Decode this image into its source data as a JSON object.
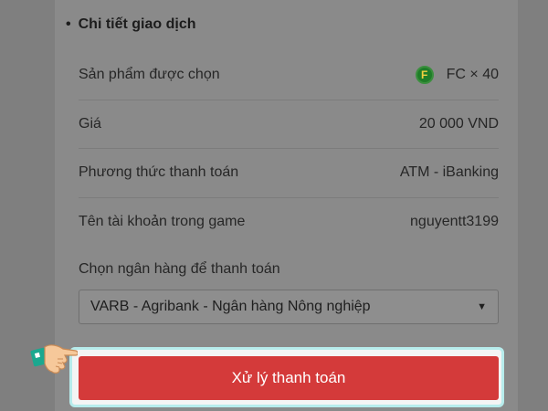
{
  "section": {
    "bullet": "•",
    "title": "Chi tiết giao dịch"
  },
  "rows": [
    {
      "label": "Sản phẩm được chọn",
      "value": "FC × 40",
      "icon": "fc-coin-icon",
      "icon_text": "F"
    },
    {
      "label": "Giá",
      "value": "20 000 VND"
    },
    {
      "label": "Phương thức thanh toán",
      "value": "ATM - iBanking"
    },
    {
      "label": "Tên tài khoản trong game",
      "value": "nguyentt3199"
    }
  ],
  "bank": {
    "label": "Chọn ngân hàng để thanh toán",
    "selected": "VARB - Agribank - Ngân hàng Nông nghiệp",
    "caret": "▼"
  },
  "pay_button": {
    "label": "Xử lý thanh toán"
  },
  "colors": {
    "button": "#d43a3a",
    "highlight": "#b7ecec",
    "coin": "#1f7d28"
  }
}
